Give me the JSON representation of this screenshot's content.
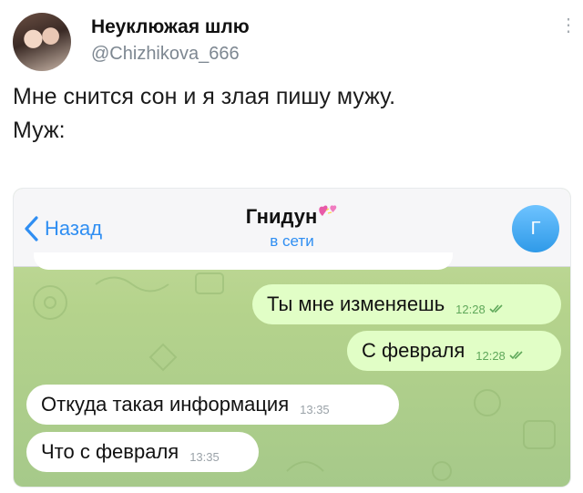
{
  "tweet": {
    "display_name": "Неуклюжая шлю",
    "handle": "@Chizhikova_666",
    "more_glyph": "⋮",
    "text_line1": "Мне снится сон и я злая пишу мужу.",
    "text_line2": "Муж:"
  },
  "chat": {
    "back_label": "Назад",
    "contact_name": "Гнидун",
    "status": "в сети",
    "avatar_letter": "Г",
    "accent_color": "#2f8ef2",
    "messages": [
      {
        "direction": "outgoing",
        "text": "Ты мне изменяешь",
        "time": "12:28",
        "read": true
      },
      {
        "direction": "outgoing",
        "text": "С февраля",
        "time": "12:28",
        "read": true
      },
      {
        "direction": "incoming",
        "text": "Откуда такая информация",
        "time": "13:35"
      },
      {
        "direction": "incoming",
        "text": "Что с февраля",
        "time": "13:35"
      }
    ]
  },
  "icons": [
    "back-chevron-icon",
    "heart-icon",
    "more-vertical-icon",
    "double-check-icon"
  ]
}
